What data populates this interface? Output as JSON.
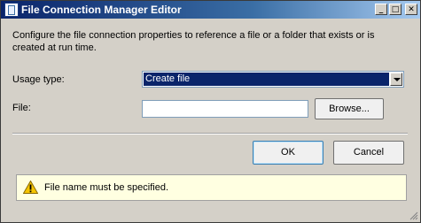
{
  "window": {
    "title": "File Connection Manager Editor",
    "title_icon": "file-connection-icon",
    "controls": {
      "minimize": "minimize-icon",
      "maximize": "maximize-icon",
      "close": "close-icon"
    }
  },
  "description": "Configure the file connection properties to reference a file or a folder that exists or is created at run time.",
  "usage_type": {
    "label": "Usage type:",
    "selected": "Create file"
  },
  "file": {
    "label": "File:",
    "value": "",
    "browse_label": "Browse..."
  },
  "buttons": {
    "ok": "OK",
    "cancel": "Cancel"
  },
  "message": {
    "icon": "warning-icon",
    "text": "File name must be specified."
  },
  "colors": {
    "title_bar": "#0a246a",
    "dialog_background": "#d4d0c8",
    "selection": "#0a246a",
    "message_background": "#ffffe1"
  }
}
